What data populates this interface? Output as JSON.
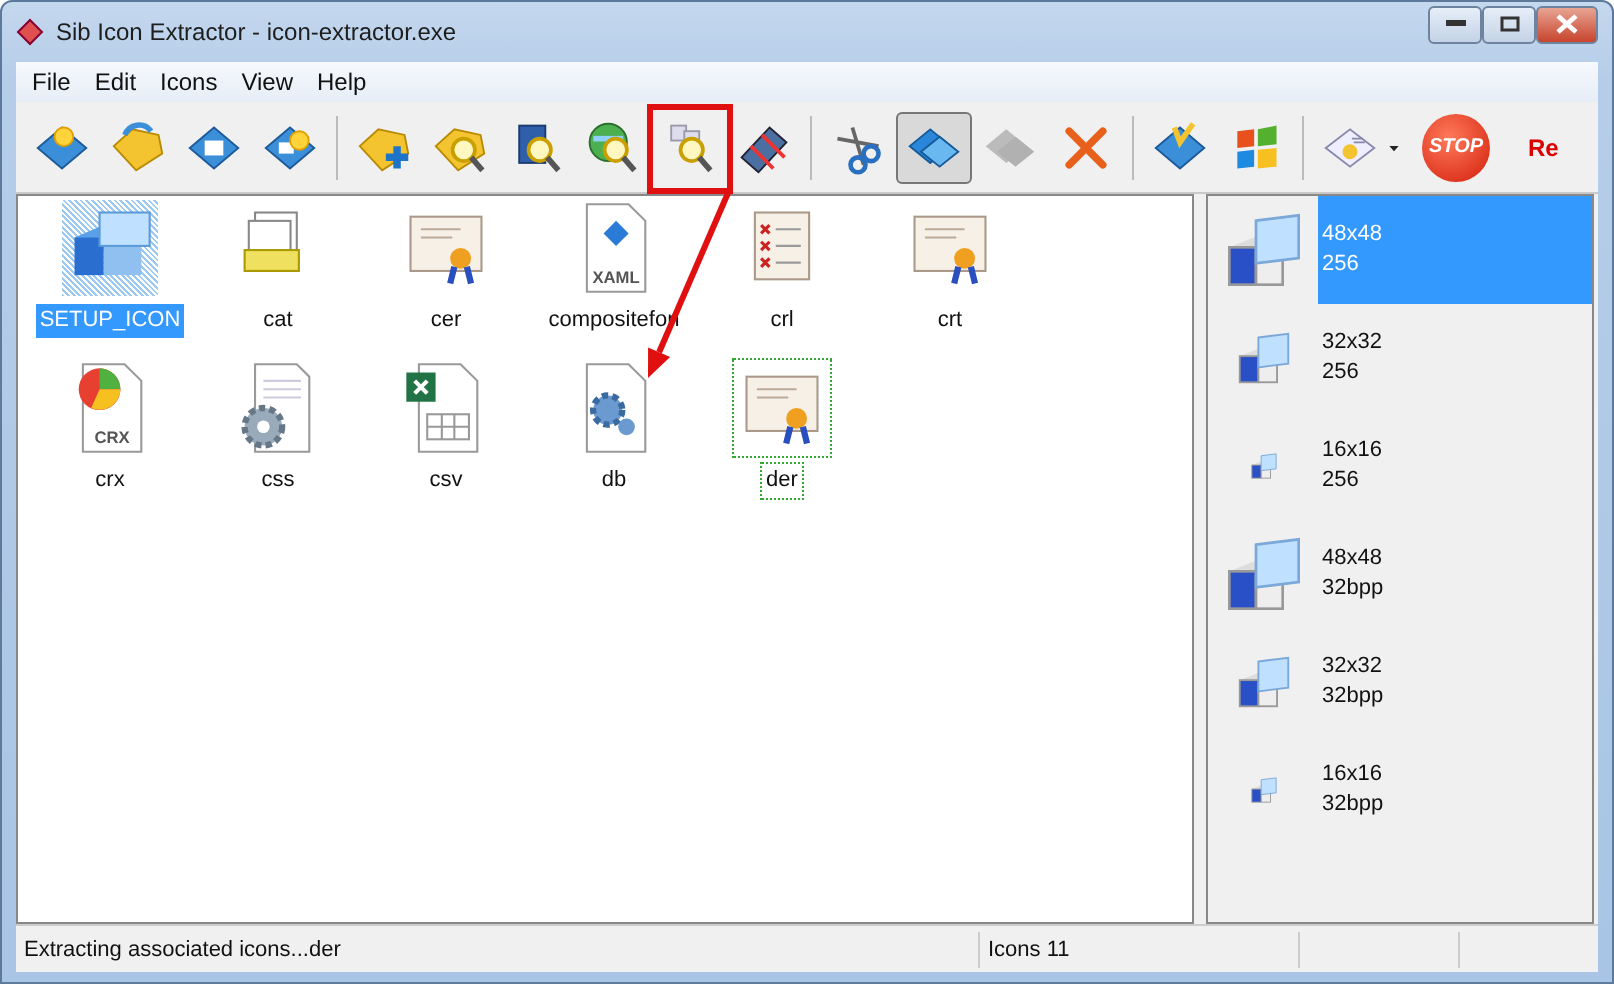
{
  "window": {
    "title": "Sib Icon Extractor - icon-extractor.exe"
  },
  "menu": [
    "File",
    "Edit",
    "Icons",
    "View",
    "Help"
  ],
  "toolbar": {
    "groups": [
      [
        {
          "pressed": false,
          "disabled": false
        },
        {
          "pressed": false,
          "disabled": false
        },
        {
          "pressed": false,
          "disabled": false
        },
        {
          "pressed": false,
          "disabled": false
        }
      ],
      [
        {
          "pressed": false,
          "disabled": false
        },
        {
          "pressed": false,
          "disabled": false
        },
        {
          "pressed": false,
          "disabled": false
        },
        {
          "pressed": false,
          "disabled": false
        },
        {
          "pressed": false,
          "disabled": false,
          "highlighted": true
        },
        {
          "pressed": false,
          "disabled": false
        }
      ],
      [
        {
          "pressed": false,
          "disabled": false
        },
        {
          "pressed": true,
          "disabled": false
        },
        {
          "pressed": false,
          "disabled": true
        },
        {
          "pressed": false,
          "disabled": false
        }
      ],
      [
        {
          "pressed": false,
          "disabled": false
        },
        {
          "pressed": false,
          "disabled": false
        }
      ],
      [
        {
          "pressed": false,
          "disabled": false,
          "has_menu": true
        },
        {
          "pressed": false,
          "disabled": false,
          "label": "STOP"
        }
      ]
    ],
    "link": "Re"
  },
  "files": [
    {
      "name": "SETUP_ICON",
      "selected": true,
      "focused": false
    },
    {
      "name": "cat",
      "selected": false,
      "focused": false
    },
    {
      "name": "cer",
      "selected": false,
      "focused": false
    },
    {
      "name": "compositefon",
      "selected": false,
      "focused": false,
      "badge": "XAML"
    },
    {
      "name": "crl",
      "selected": false,
      "focused": false
    },
    {
      "name": "crt",
      "selected": false,
      "focused": false
    },
    {
      "name": "crx",
      "selected": false,
      "focused": false,
      "badge": "CRX"
    },
    {
      "name": "css",
      "selected": false,
      "focused": false
    },
    {
      "name": "csv",
      "selected": false,
      "focused": false
    },
    {
      "name": "db",
      "selected": false,
      "focused": false,
      "arrow_target": true
    },
    {
      "name": "der",
      "selected": false,
      "focused": true
    }
  ],
  "formats": [
    {
      "size": "48x48",
      "depth": "256",
      "selected": true
    },
    {
      "size": "32x32",
      "depth": "256",
      "selected": false
    },
    {
      "size": "16x16",
      "depth": "256",
      "selected": false
    },
    {
      "size": "48x48",
      "depth": "32bpp",
      "selected": false
    },
    {
      "size": "32x32",
      "depth": "32bpp",
      "selected": false
    },
    {
      "size": "16x16",
      "depth": "32bpp",
      "selected": false
    }
  ],
  "status_bar": {
    "message": "Extracting associated icons...der",
    "count": "Icons 11"
  }
}
